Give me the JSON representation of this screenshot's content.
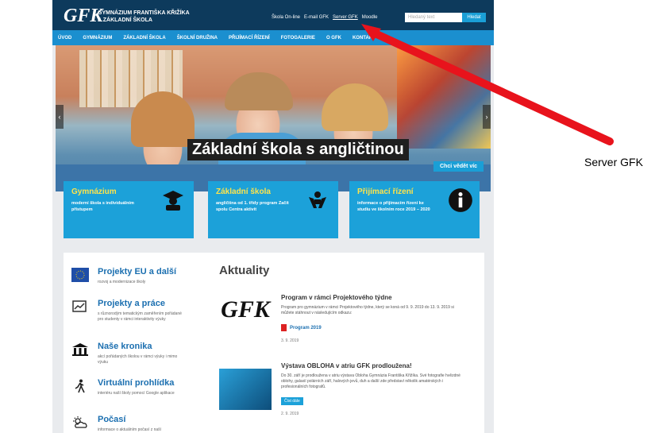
{
  "site": {
    "logo_text": "GFK",
    "school_name_line1": "GYMNÁZIUM FRANTIŠKA KŘIŽÍKA",
    "school_name_line2": "A ZÁKLADNÍ ŠKOLA",
    "top_links": [
      "Škola On-line",
      "E-mail GFK",
      "Server GFK",
      "Moodle"
    ],
    "search_placeholder": "Hledaný text",
    "search_button": "Hledat"
  },
  "nav": [
    "ÚVOD",
    "GYMNÁZIUM",
    "ZÁKLADNÍ ŠKOLA",
    "ŠKOLNÍ DRUŽINA",
    "PŘIJÍMACÍ ŘÍZENÍ",
    "FOTOGALERIE",
    "O GFK",
    "KONTAKT"
  ],
  "hero": {
    "caption": "Základní škola s angličtinou",
    "button": "Chci vědět víc"
  },
  "features": [
    {
      "title": "Gymnázium",
      "desc": "moderní škola s individuálním přístupem",
      "icon": "graduate-icon"
    },
    {
      "title": "Základní škola",
      "desc": "angličtina od 1. třídy program Začít spolu Centra aktivit",
      "icon": "hands-icon"
    },
    {
      "title": "Přijímací řízení",
      "desc": "informace o přijímacím řízení ke studiu ve školním roce 2019 – 2020",
      "icon": "info-icon"
    }
  ],
  "sidebar": [
    {
      "title": "Projekty EU a další",
      "desc": "rozvoj a modernizace školy",
      "icon": "eu-flag-icon"
    },
    {
      "title": "Projekty a práce",
      "desc": "s různorodým tematickým zaměřením pořádané pro studenty v rámci interaktivity výuky",
      "icon": "chart-icon"
    },
    {
      "title": "Naše kronika",
      "desc": "akcí pořádaných školou v rámci výuky i mimo výuku",
      "icon": "building-icon"
    },
    {
      "title": "Virtuální prohlídka",
      "desc": "interiéru naší školy pomocí Google aplikace",
      "icon": "walker-icon"
    },
    {
      "title": "Počasí",
      "desc": "informace o aktuálním počasí z naší",
      "icon": "weather-icon"
    }
  ],
  "news": {
    "heading": "Aktuality",
    "articles": [
      {
        "title": "Program v rámci Projektového týdne",
        "desc": "Program pro gymnázium v rámci Projektového týdne, který se koná od 9. 9. 2019 do 13. 9. 2019 si můžete stáhnout v následujícím odkazu:",
        "link": "Program 2019",
        "date": "3. 9. 2019"
      },
      {
        "title": "Výstava OBLOHA v atriu GFK prodloužena!",
        "desc": "Do 30. září je prodloužena v atriu výstava Obloha Gymnázia Františka Křižíka. Své fotografie hvězdné oblohy, galaxií polárních září, halových jevů, duh a další zde představí několik amatérských i profesionálních fotografů.",
        "button": "Číst dále",
        "date": "2. 9. 2019"
      }
    ]
  },
  "annotation": "Server GFK",
  "colors": {
    "header": "#0d3a5c",
    "nav": "#1b8fcf",
    "accent": "#1ca1d9",
    "feature_title": "#ffe34a",
    "arrow": "#e8131c"
  }
}
